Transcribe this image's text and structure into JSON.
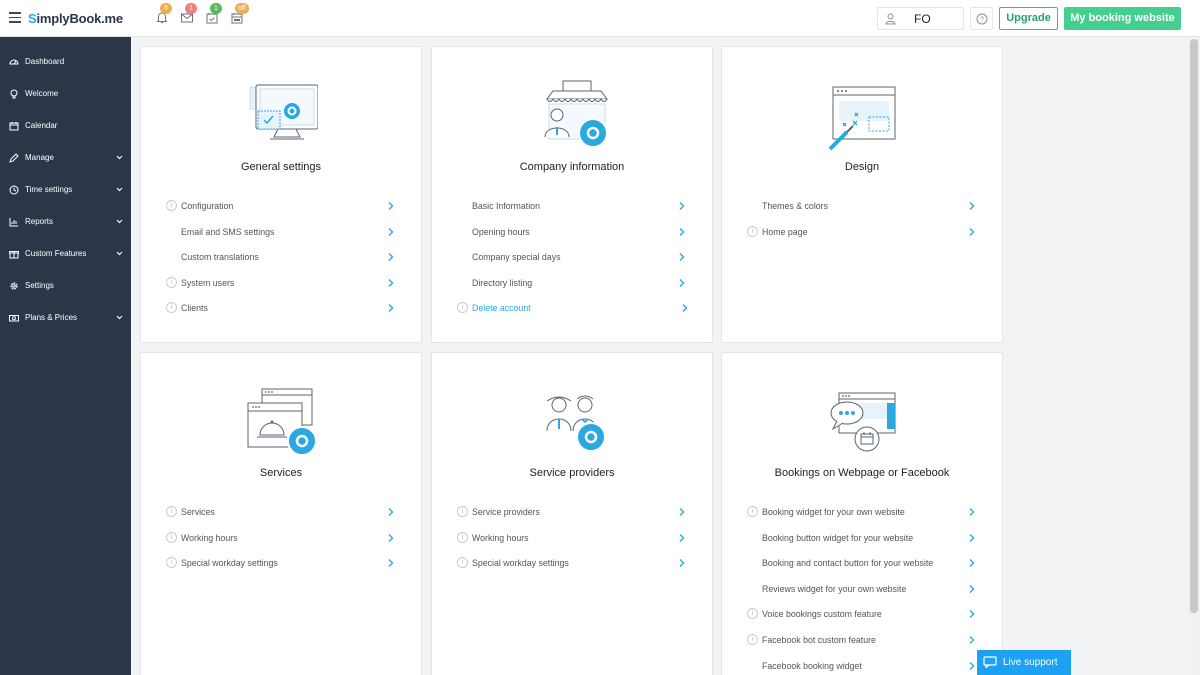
{
  "app": {
    "logo_prefix": "S",
    "logo_rest": "implyBook.me"
  },
  "topbar": {
    "notifications": [
      {
        "icon": "bell-icon",
        "badge": "5",
        "badge_color": "#f0ad4e"
      },
      {
        "icon": "envelope-icon",
        "badge": "1",
        "badge_color": "#f08080"
      },
      {
        "icon": "calendar-check-icon",
        "badge": "1",
        "badge_color": "#5cb85c"
      },
      {
        "icon": "calendar-off-icon",
        "badge": "off",
        "badge_color": "#f0ad4e"
      }
    ],
    "user_initials": "FO",
    "upgrade_label": "Upgrade",
    "my_booking_label": "My booking website"
  },
  "sidebar": {
    "items": [
      {
        "label": "Dashboard",
        "icon": "dashboard-icon",
        "expandable": false
      },
      {
        "label": "Welcome",
        "icon": "lightbulb-icon",
        "expandable": false
      },
      {
        "label": "Calendar",
        "icon": "calendar-icon",
        "expandable": false
      },
      {
        "label": "Manage",
        "icon": "pencil-icon",
        "expandable": true
      },
      {
        "label": "Time settings",
        "icon": "clock-icon",
        "expandable": true
      },
      {
        "label": "Reports",
        "icon": "bar-chart-icon",
        "expandable": true
      },
      {
        "label": "Custom Features",
        "icon": "gift-icon",
        "expandable": true
      },
      {
        "label": "Settings",
        "icon": "gear-icon",
        "expandable": false
      },
      {
        "label": "Plans & Prices",
        "icon": "money-icon",
        "expandable": true
      }
    ]
  },
  "cards": {
    "general": {
      "title": "General settings",
      "items": [
        {
          "label": "Configuration",
          "info": true
        },
        {
          "label": "Email and SMS settings",
          "info": false
        },
        {
          "label": "Custom translations",
          "info": false
        },
        {
          "label": "System users",
          "info": true
        },
        {
          "label": "Clients",
          "info": true
        }
      ]
    },
    "company": {
      "title": "Company information",
      "items": [
        {
          "label": "Basic Information",
          "info": false
        },
        {
          "label": "Opening hours",
          "info": false
        },
        {
          "label": "Company special days",
          "info": false
        },
        {
          "label": "Directory listing",
          "info": false
        },
        {
          "label": "Delete account",
          "info": true,
          "link": true
        }
      ]
    },
    "design": {
      "title": "Design",
      "items": [
        {
          "label": "Themes & colors",
          "info": false
        },
        {
          "label": "Home page",
          "info": true
        }
      ]
    },
    "services": {
      "title": "Services",
      "items": [
        {
          "label": "Services",
          "info": true
        },
        {
          "label": "Working hours",
          "info": true
        },
        {
          "label": "Special workday settings",
          "info": true
        }
      ]
    },
    "providers": {
      "title": "Service providers",
      "items": [
        {
          "label": "Service providers",
          "info": true
        },
        {
          "label": "Working hours",
          "info": true
        },
        {
          "label": "Special workday settings",
          "info": true
        }
      ]
    },
    "bookings": {
      "title": "Bookings on Webpage or Facebook",
      "items": [
        {
          "label": "Booking widget for your own website",
          "info": true
        },
        {
          "label": "Booking button widget for your website",
          "info": false
        },
        {
          "label": "Booking and contact button for your website",
          "info": false
        },
        {
          "label": "Reviews widget for your own website",
          "info": false
        },
        {
          "label": "Voice bookings custom feature",
          "info": true
        },
        {
          "label": "Facebook bot custom feature",
          "info": true
        },
        {
          "label": "Facebook booking widget",
          "info": false
        }
      ]
    }
  },
  "live_support": {
    "label": "Live support"
  },
  "colors": {
    "accent": "#2aa8e0",
    "sidebar_bg": "#2b3648",
    "green": "#44cf8f"
  }
}
